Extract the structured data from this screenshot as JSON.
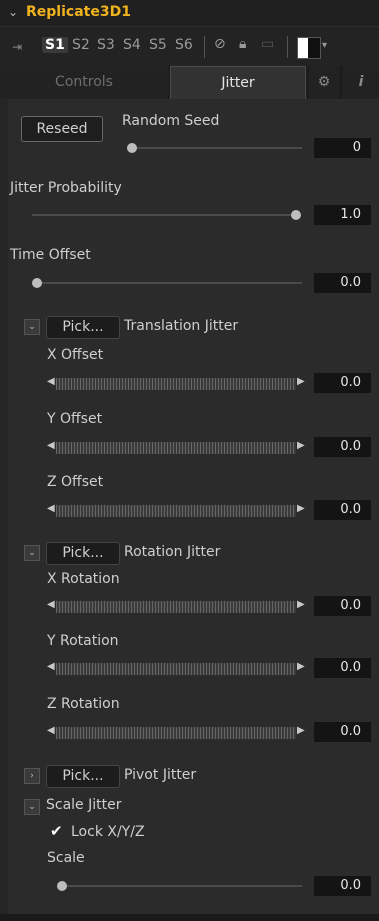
{
  "header": {
    "chevron_icon": "chevron-down-icon",
    "title": "Replicate3D1"
  },
  "slots": {
    "pin_icon": "pin-icon",
    "items": [
      "S1",
      "S2",
      "S3",
      "S4",
      "S5",
      "S6"
    ],
    "active": "S1",
    "icons": [
      "disable-icon",
      "lock-icon",
      "cache-icon",
      "color-swatch",
      "dropdown-arrow"
    ]
  },
  "tabs": {
    "controls": "Controls",
    "jitter": "Jitter",
    "settings_icon": "gear-icon",
    "info_icon": "info-icon"
  },
  "random_seed": {
    "button": "Reseed",
    "label": "Random Seed",
    "value": "0",
    "level": 0.0
  },
  "jitter_probability": {
    "label": "Jitter Probability",
    "value": "1.0",
    "level": 1.0
  },
  "time_offset": {
    "label": "Time Offset",
    "value": "0.0",
    "level": 0.0
  },
  "translation": {
    "pick": "Pick...",
    "label": "Translation Jitter",
    "x": {
      "label": "X Offset",
      "value": "0.0"
    },
    "y": {
      "label": "Y Offset",
      "value": "0.0"
    },
    "z": {
      "label": "Z Offset",
      "value": "0.0"
    }
  },
  "rotation": {
    "pick": "Pick...",
    "label": "Rotation Jitter",
    "x": {
      "label": "X Rotation",
      "value": "0.0"
    },
    "y": {
      "label": "Y Rotation",
      "value": "0.0"
    },
    "z": {
      "label": "Z Rotation",
      "value": "0.0"
    }
  },
  "pivot": {
    "pick": "Pick...",
    "label": "Pivot Jitter"
  },
  "scale": {
    "section": "Scale Jitter",
    "lock": "Lock X/Y/Z",
    "label": "Scale",
    "value": "0.0",
    "level": 0.0
  },
  "glyphs": {
    "chev_down": "⌄",
    "chev_right": "›",
    "check": "✔",
    "left_arrow": "◀",
    "right_arrow": "▶"
  }
}
